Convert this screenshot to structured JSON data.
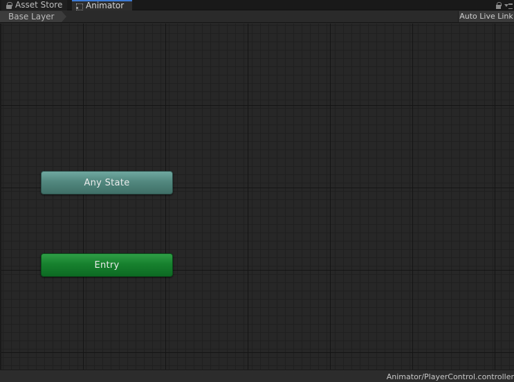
{
  "tabs": [
    {
      "label": "Asset Store",
      "icon": "lock-icon",
      "active": false
    },
    {
      "label": "Animator",
      "icon": "animator-icon",
      "active": true
    }
  ],
  "toolbar": {
    "breadcrumb": "Base Layer",
    "live_link": "Auto Live Link"
  },
  "graph": {
    "nodes": [
      {
        "label": "Any State",
        "color": "#52887f"
      },
      {
        "label": "Entry",
        "color": "#17812e"
      }
    ]
  },
  "status": {
    "controller_path": "Animator/PlayerControl.controller"
  },
  "colors": {
    "accent": "#3d7bd6",
    "any_state": "#52887f",
    "entry": "#17812e",
    "background": "#272727"
  }
}
